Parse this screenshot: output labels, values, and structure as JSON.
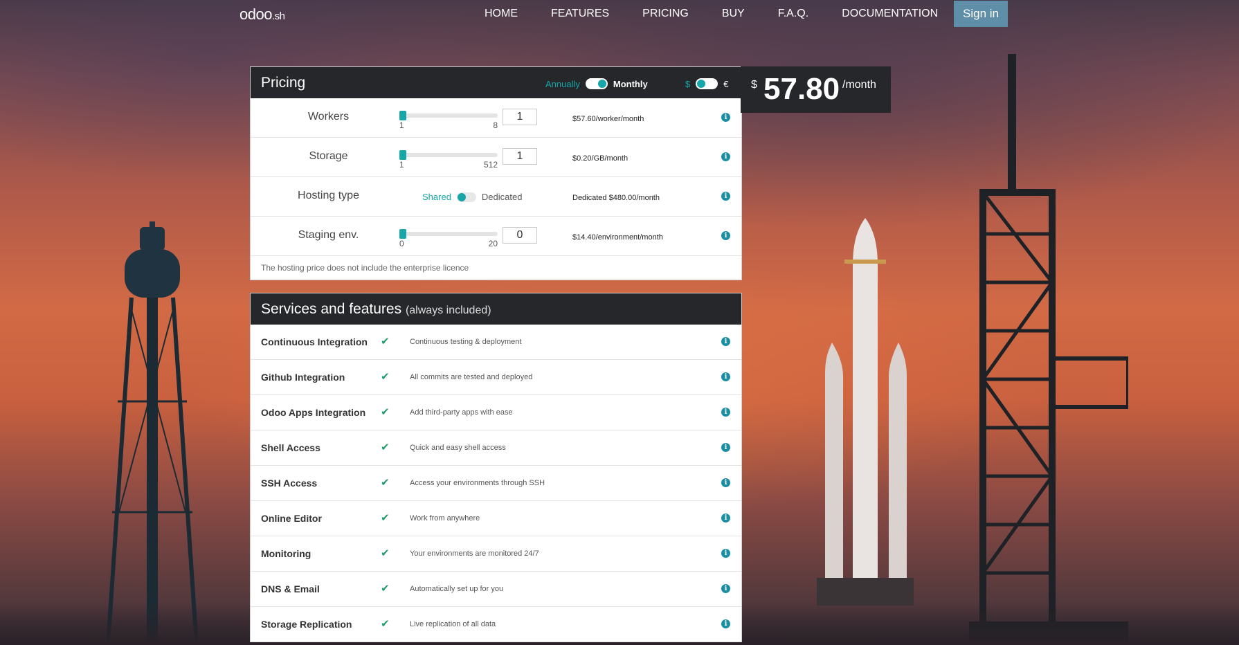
{
  "nav": {
    "logo_main": "odoo",
    "logo_suffix": ".sh",
    "links": [
      "HOME",
      "FEATURES",
      "PRICING",
      "BUY",
      "F.A.Q.",
      "DOCUMENTATION"
    ],
    "signin": "Sign in"
  },
  "pricing": {
    "title": "Pricing",
    "period_annually": "Annually",
    "period_monthly": "Monthly",
    "currency_usd": "$",
    "currency_eur": "€",
    "rows": [
      {
        "label": "Workers",
        "min": "1",
        "max": "8",
        "value": "1",
        "price": "$57.60/worker/month"
      },
      {
        "label": "Storage",
        "min": "1",
        "max": "512",
        "value": "1",
        "price": "$0.20/GB/month"
      },
      {
        "label": "Hosting type",
        "shared": "Shared",
        "dedicated": "Dedicated",
        "price": "Dedicated $480.00/month"
      },
      {
        "label": "Staging env.",
        "min": "0",
        "max": "20",
        "value": "0",
        "price": "$14.40/environment/month"
      }
    ],
    "note": "The hosting price does not include the enterprise licence"
  },
  "total": {
    "currency": "$",
    "amount": "57.80",
    "per": "/month"
  },
  "services": {
    "title": "Services and features",
    "subtitle": "(always included)",
    "items": [
      {
        "name": "Continuous Integration",
        "desc": "Continuous testing & deployment"
      },
      {
        "name": "Github Integration",
        "desc": "All commits are tested and deployed"
      },
      {
        "name": "Odoo Apps Integration",
        "desc": "Add third-party apps with ease"
      },
      {
        "name": "Shell Access",
        "desc": "Quick and easy shell access"
      },
      {
        "name": "SSH Access",
        "desc": "Access your environments through SSH"
      },
      {
        "name": "Online Editor",
        "desc": "Work from anywhere"
      },
      {
        "name": "Monitoring",
        "desc": "Your environments are monitored 24/7"
      },
      {
        "name": "DNS & Email",
        "desc": "Automatically set up for you"
      },
      {
        "name": "Storage Replication",
        "desc": "Live replication of all data"
      }
    ]
  },
  "colors": {
    "accent": "#17a7a8",
    "dark": "#25272b",
    "check": "#1f9c6b",
    "signin": "#5f8fa8"
  }
}
